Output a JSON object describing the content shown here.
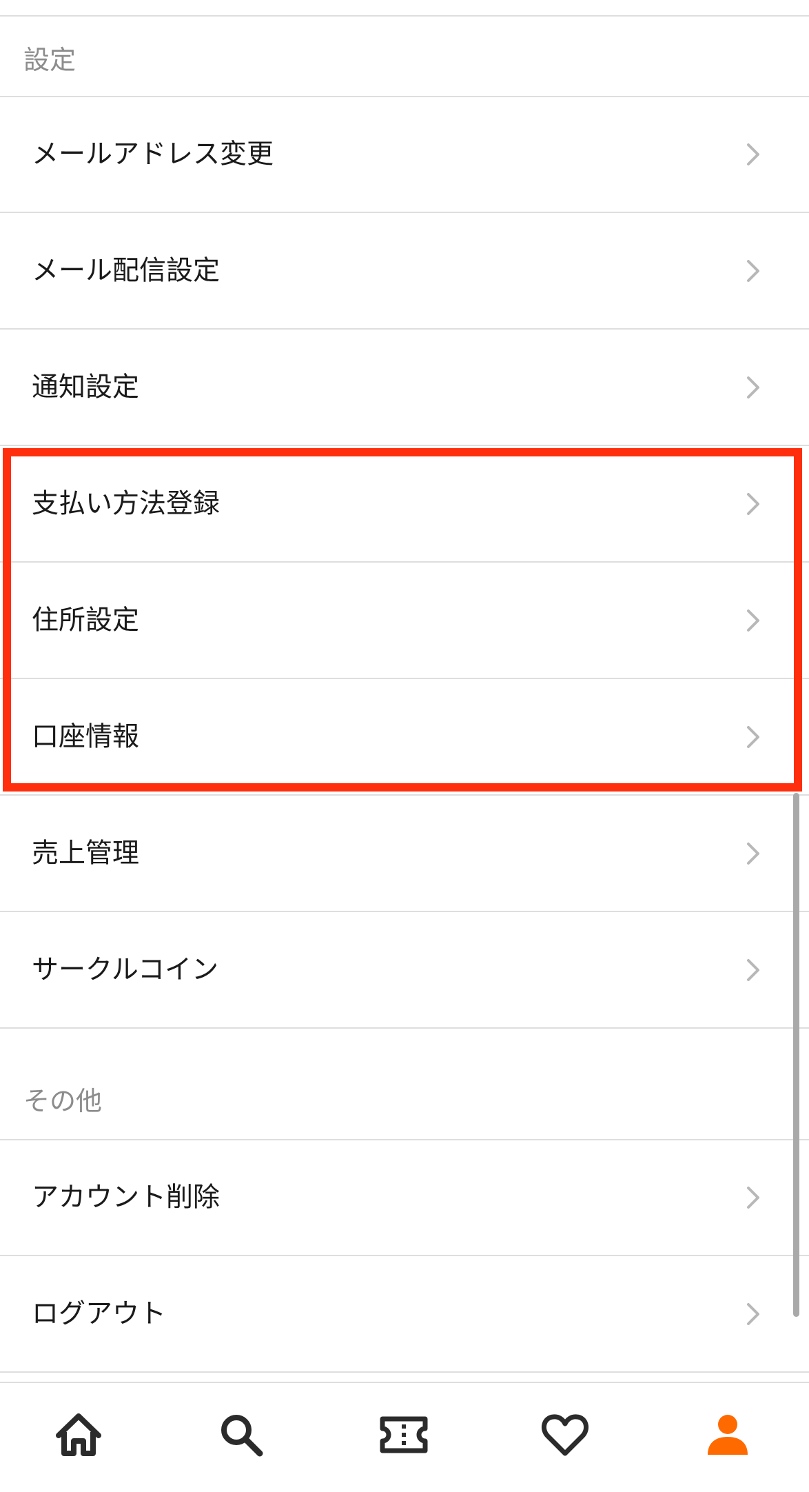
{
  "colors": {
    "highlight": "#ff2e0d",
    "accent": "#ff6a00",
    "icon_dark": "#2b2b2b",
    "chevron": "#b8b8b8",
    "section_text": "#8c8c8c"
  },
  "sections": {
    "settings": {
      "title": "設定",
      "items": [
        {
          "label": "メールアドレス変更",
          "icon": "chevron-right-icon"
        },
        {
          "label": "メール配信設定",
          "icon": "chevron-right-icon"
        },
        {
          "label": "通知設定",
          "icon": "chevron-right-icon"
        },
        {
          "label": "支払い方法登録",
          "icon": "chevron-right-icon"
        },
        {
          "label": "住所設定",
          "icon": "chevron-right-icon"
        },
        {
          "label": "口座情報",
          "icon": "chevron-right-icon"
        },
        {
          "label": "売上管理",
          "icon": "chevron-right-icon"
        },
        {
          "label": "サークルコイン",
          "icon": "chevron-right-icon"
        }
      ]
    },
    "other": {
      "title": "その他",
      "items": [
        {
          "label": "アカウント削除",
          "icon": "chevron-right-icon"
        },
        {
          "label": "ログアウト",
          "icon": "chevron-right-icon"
        }
      ]
    }
  },
  "tabbar": {
    "tabs": [
      {
        "icon": "home-icon",
        "active": false
      },
      {
        "icon": "search-icon",
        "active": false
      },
      {
        "icon": "ticket-icon",
        "active": false
      },
      {
        "icon": "heart-icon",
        "active": false
      },
      {
        "icon": "profile-icon",
        "active": true
      }
    ]
  }
}
